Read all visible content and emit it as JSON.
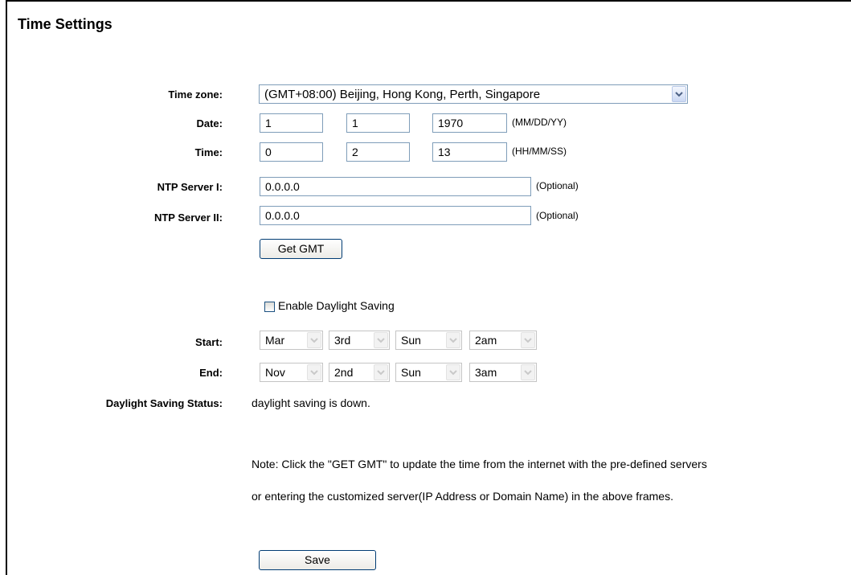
{
  "page": {
    "title": "Time Settings"
  },
  "labels": {
    "time_zone": "Time zone:",
    "date": "Date:",
    "time": "Time:",
    "ntp1": "NTP Server I:",
    "ntp2": "NTP Server II:",
    "start": "Start:",
    "end": "End:",
    "dst_status": "Daylight Saving Status:"
  },
  "time_zone": {
    "value": "(GMT+08:00) Beijing, Hong Kong, Perth, Singapore"
  },
  "date": {
    "month": "1",
    "day": "1",
    "year": "1970",
    "format": "(MM/DD/YY)"
  },
  "time": {
    "hour": "0",
    "minute": "2",
    "second": "13",
    "format": "(HH/MM/SS)"
  },
  "ntp": {
    "server1": "0.0.0.0",
    "server2": "0.0.0.0",
    "optional_label": "(Optional)"
  },
  "get_gmt_button": "Get GMT",
  "daylight": {
    "enable_label": "Enable Daylight Saving",
    "enabled": false,
    "start": {
      "month": "Mar",
      "week": "3rd",
      "day": "Sun",
      "hour": "2am"
    },
    "end": {
      "month": "Nov",
      "week": "2nd",
      "day": "Sun",
      "hour": "3am"
    },
    "status": "daylight saving is down."
  },
  "note": {
    "line1": "Note: Click the \"GET GMT\" to update the time from the internet with the pre-defined servers",
    "line2": "or entering the customized server(IP Address or Domain Name) in the above frames."
  },
  "save_button": "Save",
  "colors": {
    "input_border": "#7f9db9",
    "button_border": "#003c74"
  }
}
